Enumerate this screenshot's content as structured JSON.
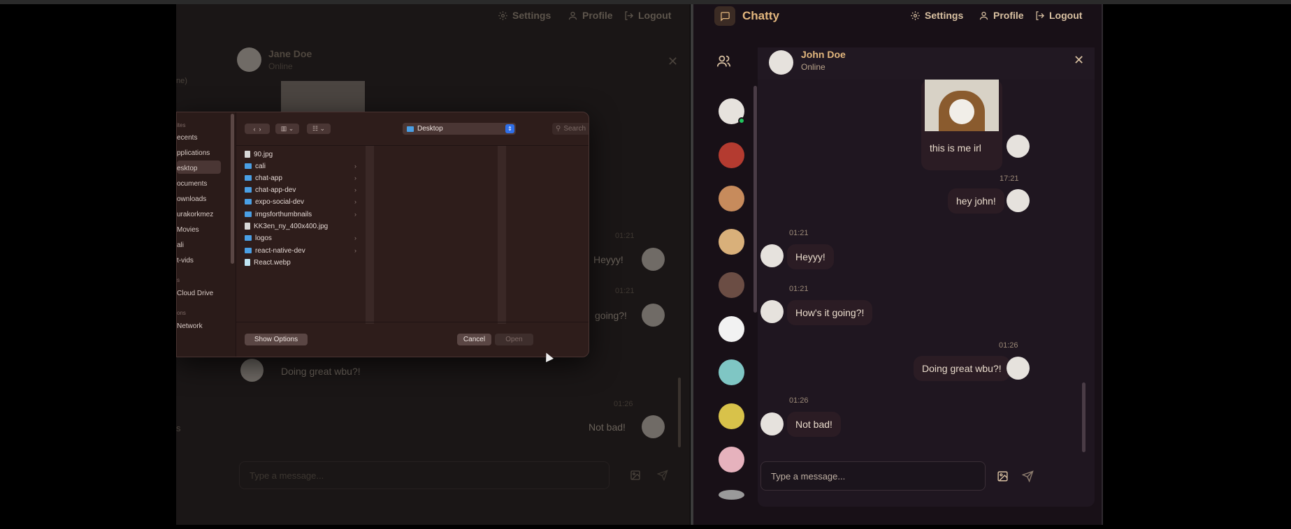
{
  "left_window": {
    "nav": {
      "settings": "Settings",
      "profile": "Profile",
      "logout": "Logout"
    },
    "contact": {
      "name": "Jane Doe",
      "status": "Online"
    },
    "side_fragment": "ne)",
    "side_fragment_2": "s",
    "messages": [
      {
        "time": "01:21",
        "text": "Heyyy!"
      },
      {
        "time": "01:21",
        "text": "going?!"
      },
      {
        "text": "Doing great wbu?!"
      },
      {
        "time": "01:26",
        "text": "Not bad!"
      }
    ],
    "input_placeholder": "Type a message..."
  },
  "file_dialog": {
    "sidebar_heads": [
      "ites",
      "s",
      "ons"
    ],
    "sidebar_items": [
      "ecents",
      "pplications",
      "esktop",
      "ocuments",
      "ownloads",
      "urakorkmez",
      "Movies",
      "ali",
      "t-vids",
      "Cloud Drive",
      "Network"
    ],
    "location": "Desktop",
    "search_placeholder": "Search",
    "files": [
      {
        "name": "90.jpg",
        "kind": "image"
      },
      {
        "name": "cali",
        "kind": "folder"
      },
      {
        "name": "chat-app",
        "kind": "folder"
      },
      {
        "name": "chat-app-dev",
        "kind": "folder"
      },
      {
        "name": "expo-social-dev",
        "kind": "folder"
      },
      {
        "name": "imgsforthumbnails",
        "kind": "folder"
      },
      {
        "name": "KK3en_ny_400x400.jpg",
        "kind": "image"
      },
      {
        "name": "logos",
        "kind": "folder"
      },
      {
        "name": "react-native-dev",
        "kind": "folder"
      },
      {
        "name": "React.webp",
        "kind": "doc"
      }
    ],
    "show_options": "Show Options",
    "cancel": "Cancel",
    "open": "Open"
  },
  "right_window": {
    "brand": "Chatty",
    "nav": {
      "settings": "Settings",
      "profile": "Profile",
      "logout": "Logout"
    },
    "contact": {
      "name": "John Doe",
      "status": "Online"
    },
    "messages": [
      {
        "side": "right",
        "text": "this is me irl"
      },
      {
        "side": "right",
        "time": "17:21",
        "text": "hey john!"
      },
      {
        "side": "left",
        "time": "01:21",
        "text": "Heyyy!"
      },
      {
        "side": "left",
        "time": "01:21",
        "text": "How's it going?!"
      },
      {
        "side": "right",
        "time": "01:26",
        "text": "Doing great wbu?!"
      },
      {
        "side": "left",
        "time": "01:26",
        "text": "Not bad!"
      }
    ],
    "input_placeholder": "Type a message..."
  },
  "colors": {
    "accent": "#e3b77e",
    "online": "#22c55e",
    "bubble": "#2b1c24",
    "panel": "#1f1620"
  },
  "icons": [
    "gear-icon",
    "user-icon",
    "logout-icon",
    "chat-icon",
    "users-icon",
    "close-icon",
    "image-icon",
    "send-icon",
    "search-icon",
    "folder-icon"
  ]
}
